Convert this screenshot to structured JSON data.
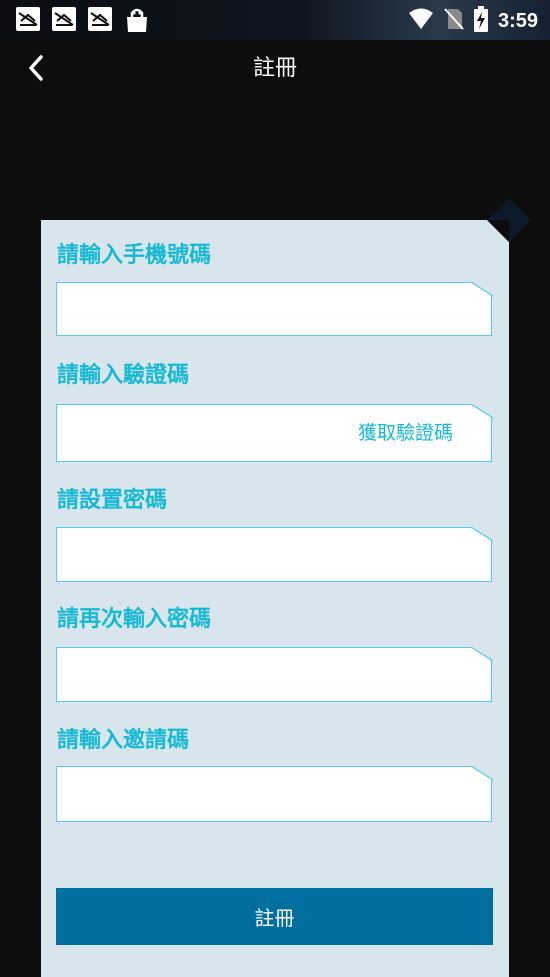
{
  "status_bar": {
    "time": "3:59",
    "icons": [
      "notification-icon",
      "notification-icon",
      "notification-icon",
      "shopping-bag-icon",
      "wifi-icon",
      "no-sim-icon",
      "battery-charging-icon"
    ]
  },
  "header": {
    "title": "註冊",
    "back_icon": "chevron-left-icon"
  },
  "form": {
    "phone_label": "請輸入手機號碼",
    "code_label": "請輸入驗證碼",
    "get_code_label": "獲取驗證碼",
    "password_label": "請設置密碼",
    "confirm_label": "請再次輸入密碼",
    "invite_label": "請輸入邀請碼",
    "phone_value": "",
    "code_value": "",
    "password_value": "",
    "confirm_value": "",
    "invite_value": ""
  },
  "register_label": "註冊",
  "colors": {
    "accent": "#17b9d3",
    "button": "#006f9f",
    "card": "#d9e5ec",
    "background": "#0d0d0d"
  }
}
